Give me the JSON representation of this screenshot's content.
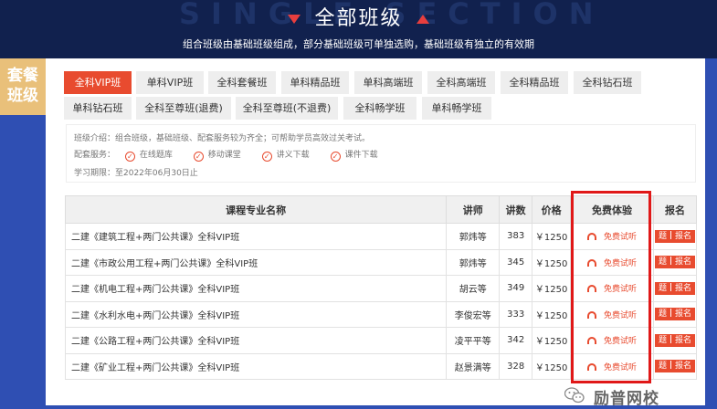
{
  "header": {
    "bg_text": "SINGLE SECTION",
    "title": "全部班级",
    "subtitle": "组合班级由基础班级组成，部分基础班级可单独选购，基础班级有独立的有效期"
  },
  "sidebar": {
    "tag": "套餐班级"
  },
  "tabs": [
    {
      "label": "全科VIP班",
      "active": true
    },
    {
      "label": "单科VIP班",
      "active": false
    },
    {
      "label": "全科套餐班",
      "active": false
    },
    {
      "label": "单科精品班",
      "active": false
    },
    {
      "label": "单科高端班",
      "active": false
    },
    {
      "label": "全科高端班",
      "active": false
    },
    {
      "label": "全科精品班",
      "active": false
    },
    {
      "label": "全科钻石班",
      "active": false
    },
    {
      "label": "单科钻石班",
      "active": false
    },
    {
      "label": "全科至尊班(退费)",
      "active": false
    },
    {
      "label": "全科至尊班(不退费)",
      "active": false
    },
    {
      "label": "全科畅学班",
      "active": false
    },
    {
      "label": "单科畅学班",
      "active": false
    }
  ],
  "info": {
    "intro": "班级介绍：组合班级，基础班级、配套服务较为齐全；可帮助学员高效过关考试。",
    "service_label": "配套服务：",
    "services": [
      "在线题库",
      "移动课堂",
      "讲义下载",
      "课件下载"
    ],
    "period": "学习期限：至2022年06月30日止"
  },
  "table": {
    "headers": [
      "课程专业名称",
      "讲师",
      "讲数",
      "价格",
      "免费体验",
      "报名"
    ],
    "rows": [
      {
        "name": "二建《建筑工程+两门公共课》全科VIP班",
        "teacher": "郭炜等",
        "lessons": "383",
        "price": "￥1250",
        "free": "免费试听",
        "signup_a": "题",
        "signup_b": "报名"
      },
      {
        "name": "二建《市政公用工程+两门公共课》全科VIP班",
        "teacher": "郭炜等",
        "lessons": "345",
        "price": "￥1250",
        "free": "免费试听",
        "signup_a": "题",
        "signup_b": "报名"
      },
      {
        "name": "二建《机电工程+两门公共课》全科VIP班",
        "teacher": "胡云等",
        "lessons": "349",
        "price": "￥1250",
        "free": "免费试听",
        "signup_a": "题",
        "signup_b": "报名"
      },
      {
        "name": "二建《水利水电+两门公共课》全科VIP班",
        "teacher": "李俊宏等",
        "lessons": "333",
        "price": "￥1250",
        "free": "免费试听",
        "signup_a": "题",
        "signup_b": "报名"
      },
      {
        "name": "二建《公路工程+两门公共课》全科VIP班",
        "teacher": "凌平平等",
        "lessons": "342",
        "price": "￥1250",
        "free": "免费试听",
        "signup_a": "题",
        "signup_b": "报名"
      },
      {
        "name": "二建《矿业工程+两门公共课》全科VIP班",
        "teacher": "赵景满等",
        "lessons": "328",
        "price": "￥1250",
        "free": "免费试听",
        "signup_a": "题",
        "signup_b": "报名"
      }
    ]
  },
  "watermark": {
    "text": "励普网校"
  },
  "colors": {
    "accent": "#e84b2f",
    "header_bg": "#11214e",
    "sidebar_blue": "#2f4fb3",
    "tag_gold": "#e9c07a",
    "highlight": "#e01818"
  }
}
